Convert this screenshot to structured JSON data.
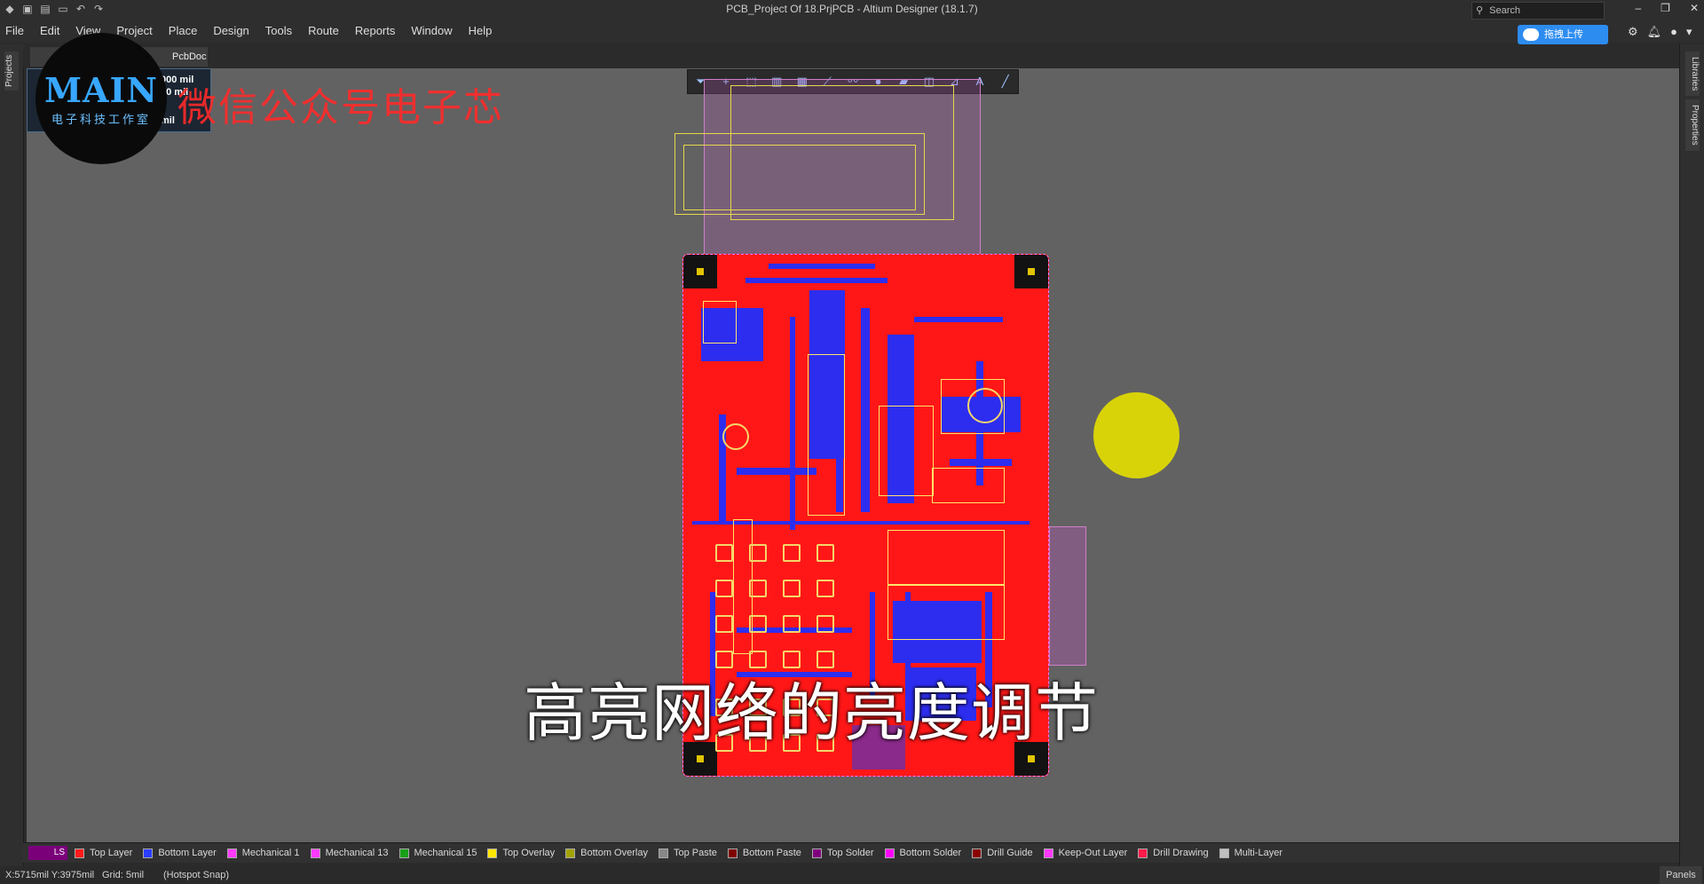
{
  "titlebar": {
    "title": "PCB_Project Of 18.PrjPCB - Altium Designer (18.1.7)",
    "search_placeholder": "Search"
  },
  "menu": [
    "File",
    "Edit",
    "View",
    "Project",
    "Place",
    "Design",
    "Tools",
    "Route",
    "Reports",
    "Window",
    "Help"
  ],
  "upload_button": "拖拽上传",
  "left_panel_tab": "Projects",
  "right_panel_tabs": [
    "Libraries",
    "Properties"
  ],
  "document_tab": "PcbDoc",
  "hud": {
    "line1": "000 mil",
    "line2": "00 mil",
    "line3": "mil"
  },
  "watermark": {
    "logo_main": "MAIN",
    "logo_sub": "电子科技工作室",
    "wechat": "微信公众号电子芯"
  },
  "caption": "高亮网络的亮度调节",
  "layers": {
    "ls_label": "LS",
    "items": [
      {
        "name": "Top Layer",
        "color": "#ff1a1a"
      },
      {
        "name": "Bottom Layer",
        "color": "#2a3dff"
      },
      {
        "name": "Mechanical 1",
        "color": "#ff39ff"
      },
      {
        "name": "Mechanical 13",
        "color": "#ff39ff"
      },
      {
        "name": "Mechanical 15",
        "color": "#19a019"
      },
      {
        "name": "Top Overlay",
        "color": "#ffe600"
      },
      {
        "name": "Bottom Overlay",
        "color": "#a3a300"
      },
      {
        "name": "Top Paste",
        "color": "#888888"
      },
      {
        "name": "Bottom Paste",
        "color": "#800000"
      },
      {
        "name": "Top Solder",
        "color": "#800080"
      },
      {
        "name": "Bottom Solder",
        "color": "#ff00ff"
      },
      {
        "name": "Drill Guide",
        "color": "#8b0000"
      },
      {
        "name": "Keep-Out Layer",
        "color": "#ff39ff"
      },
      {
        "name": "Drill Drawing",
        "color": "#ff1a4b"
      },
      {
        "name": "Multi-Layer",
        "color": "#c0c0c0"
      }
    ]
  },
  "status": {
    "coords": "X:5715mil Y:3975mil",
    "grid": "Grid: 5mil",
    "snap": "(Hotspot Snap)",
    "panels": "Panels"
  },
  "colors": {
    "board_red": "#ff1717",
    "trace_blue": "#2d2df0",
    "silk_yellow": "#ffe66a",
    "outline_magenta": "#ff78ff"
  }
}
